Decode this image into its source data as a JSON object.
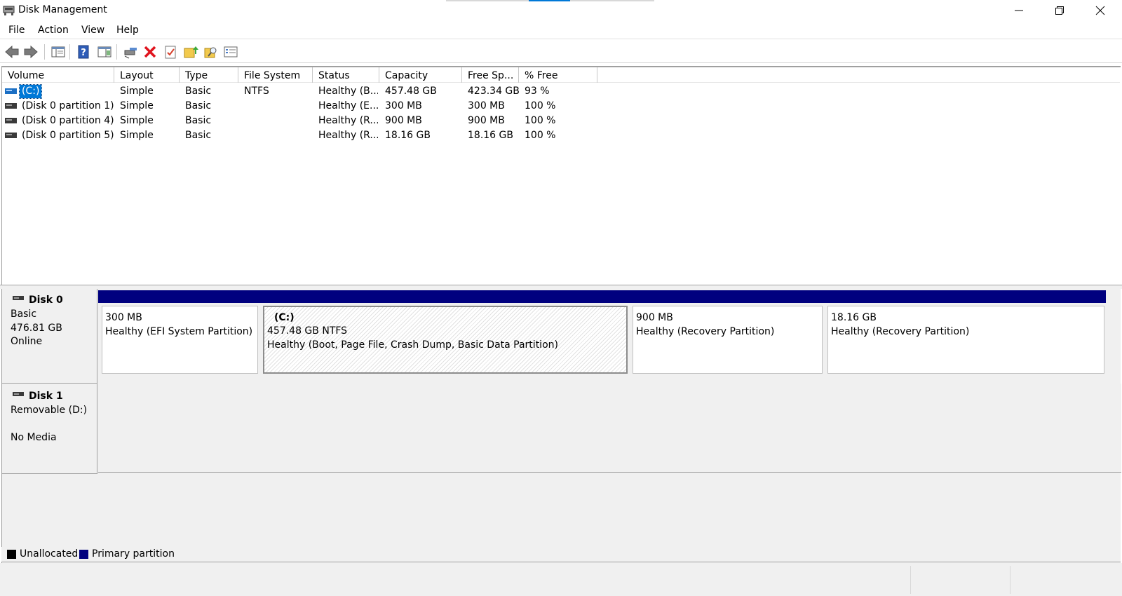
{
  "window": {
    "title": "Disk Management",
    "accent_color": "#0078d7",
    "controls": [
      "minimize-icon",
      "restore-icon",
      "close-icon"
    ]
  },
  "menu": {
    "items": [
      "File",
      "Action",
      "View",
      "Help"
    ]
  },
  "toolbar": {
    "buttons": [
      {
        "name": "back-button",
        "icon": "arrow-left-icon"
      },
      {
        "name": "forward-button",
        "icon": "arrow-right-icon"
      },
      {
        "name": "show-hide-console-tree-button",
        "icon": "console-tree-icon"
      },
      {
        "name": "help-button",
        "icon": "help-icon"
      },
      {
        "name": "properties-pane-button",
        "icon": "properties-pane-icon"
      },
      {
        "name": "connect-virtual-disk-button",
        "icon": "disk-key-icon"
      },
      {
        "name": "delete-button",
        "icon": "delete-x-icon"
      },
      {
        "name": "check-properties-button",
        "icon": "checklist-icon"
      },
      {
        "name": "open-folder-button",
        "icon": "folder-up-icon"
      },
      {
        "name": "search-folder-button",
        "icon": "folder-search-icon"
      },
      {
        "name": "view-list-button",
        "icon": "list-view-icon"
      }
    ]
  },
  "volume_list": {
    "columns": [
      "Volume",
      "Layout",
      "Type",
      "File System",
      "Status",
      "Capacity",
      "Free Sp...",
      "% Free"
    ],
    "rows": [
      {
        "volume": "(C:)",
        "layout": "Simple",
        "type": "Basic",
        "fs": "NTFS",
        "status": "Healthy (B...",
        "capacity": "457.48 GB",
        "free": "423.34 GB",
        "pct": "93 %",
        "selected": true,
        "icon_color": "#1b6fc4"
      },
      {
        "volume": "(Disk 0 partition 1)",
        "layout": "Simple",
        "type": "Basic",
        "fs": "",
        "status": "Healthy (E...",
        "capacity": "300 MB",
        "free": "300 MB",
        "pct": "100 %",
        "selected": false,
        "icon_color": "#3a3a3a"
      },
      {
        "volume": "(Disk 0 partition 4)",
        "layout": "Simple",
        "type": "Basic",
        "fs": "",
        "status": "Healthy (R...",
        "capacity": "900 MB",
        "free": "900 MB",
        "pct": "100 %",
        "selected": false,
        "icon_color": "#3a3a3a"
      },
      {
        "volume": "(Disk 0 partition 5)",
        "layout": "Simple",
        "type": "Basic",
        "fs": "",
        "status": "Healthy (R...",
        "capacity": "18.16 GB",
        "free": "18.16 GB",
        "pct": "100 %",
        "selected": false,
        "icon_color": "#3a3a3a"
      }
    ]
  },
  "disks": [
    {
      "name": "Disk 0",
      "type": "Basic",
      "size": "476.81 GB",
      "state": "Online",
      "partitions": [
        {
          "title": "",
          "size": "300 MB",
          "status": "Healthy (EFI System Partition)",
          "selected": false
        },
        {
          "title": "(C:)",
          "size": "457.48 GB NTFS",
          "status": "Healthy (Boot, Page File, Crash Dump, Basic Data Partition)",
          "selected": true
        },
        {
          "title": "",
          "size": "900 MB",
          "status": "Healthy (Recovery Partition)",
          "selected": false
        },
        {
          "title": "",
          "size": "18.16 GB",
          "status": "Healthy (Recovery Partition)",
          "selected": false
        }
      ]
    },
    {
      "name": "Disk 1",
      "type": "Removable (D:)",
      "size": "",
      "state": "No Media",
      "partitions": []
    }
  ],
  "legend": [
    {
      "label": "Unallocated",
      "color": "#000000"
    },
    {
      "label": "Primary partition",
      "color": "#00007f"
    }
  ]
}
